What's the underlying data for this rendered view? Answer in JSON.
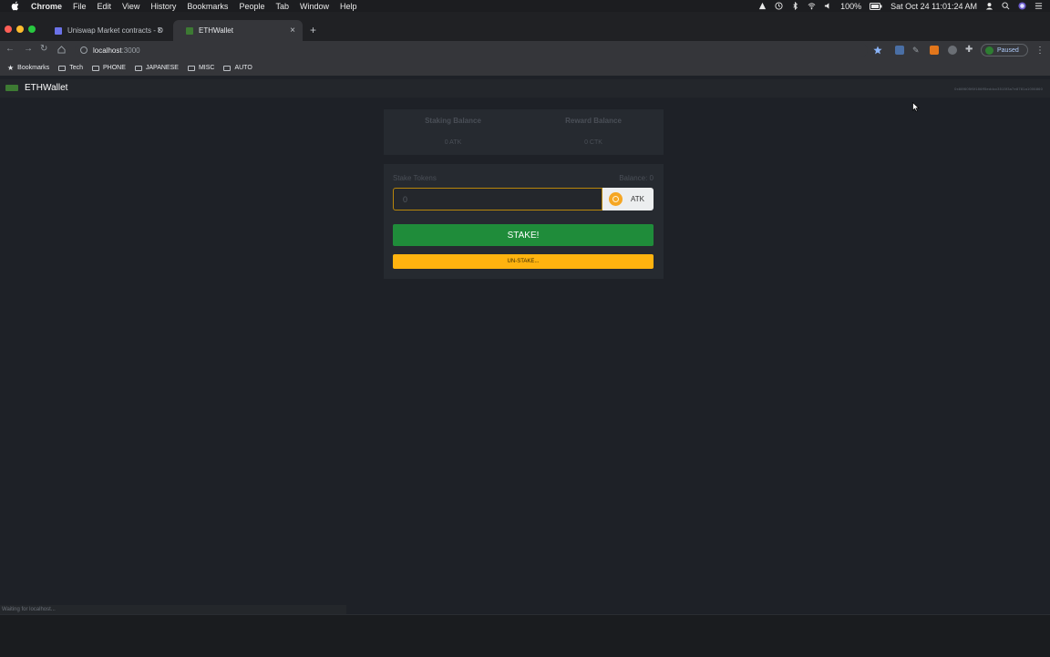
{
  "menubar": {
    "app": "Chrome",
    "items": [
      "File",
      "Edit",
      "View",
      "History",
      "Bookmarks",
      "People",
      "Tab",
      "Window",
      "Help"
    ],
    "battery": "100%",
    "datetime": "Sat Oct 24  11:01:24 AM"
  },
  "tabs": [
    {
      "title": "Uniswap Market contracts - D",
      "active": false
    },
    {
      "title": "ETHWallet",
      "active": true
    }
  ],
  "toolbar": {
    "url_host": "localhost",
    "url_port": ":3000",
    "profile_status": "Paused"
  },
  "bookmarks": [
    "Bookmarks",
    "Tech",
    "PHONE",
    "JAPANESE",
    "MISC",
    "AUTO"
  ],
  "app": {
    "brand": "ETHWallet",
    "account": "0x88f605f6f186ff5eddcc3515f3a7e8781a1006860"
  },
  "balances": {
    "staking_label": "Staking Balance",
    "staking_value": "0 ATK",
    "reward_label": "Reward Balance",
    "reward_value": "0 CTK"
  },
  "stake_form": {
    "label": "Stake Tokens",
    "balance_text": "Balance: 0",
    "input_placeholder": "0",
    "token": "ATK",
    "stake_button": "STAKE!",
    "unstake_button": "UN-STAKE..."
  },
  "status_bar": "Waiting for localhost...",
  "colors": {
    "stake_button": "#1f8c3a",
    "unstake_button": "#ffb30f",
    "input_border": "#b8860b",
    "background": "#1e2127"
  }
}
